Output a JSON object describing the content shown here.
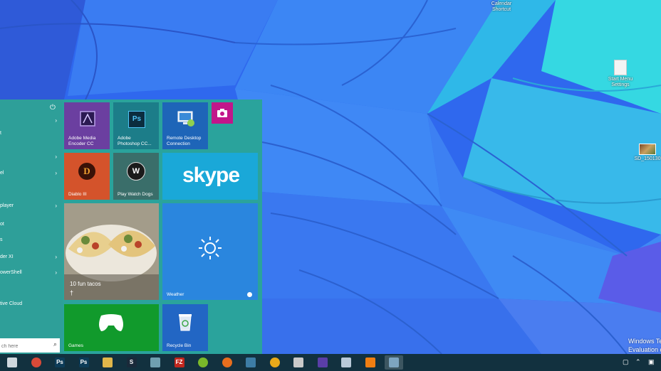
{
  "desktop": {
    "icons": [
      {
        "label": "Calendar Shortcut",
        "icon": "app-shortcut-icon"
      },
      {
        "label": "Start Menu Settings",
        "icon": "file-icon"
      },
      {
        "label": "SD_150130",
        "icon": "image-file-icon"
      }
    ],
    "watermark_line1": "Windows Tec",
    "watermark_line2": "Evaluation co"
  },
  "start_menu": {
    "power_icon": "power-icon",
    "left_items": [
      {
        "label": "",
        "chevron": true
      },
      {
        "label": "t",
        "chevron": false
      },
      {
        "label": "",
        "chevron": true
      },
      {
        "label": "el",
        "chevron": true
      },
      {
        "label": "player",
        "chevron": true
      },
      {
        "label": "ot",
        "chevron": false
      },
      {
        "label": "s",
        "chevron": false
      },
      {
        "label": "der XI",
        "chevron": true
      },
      {
        "label": "owerShell",
        "chevron": true
      },
      {
        "label": "tive Cloud",
        "chevron": false
      }
    ],
    "search_placeholder": "ch here",
    "search_icon": "search-icon",
    "tiles": {
      "media_encoder": {
        "label_line1": "Adobe Media",
        "label_line2": "Encoder CC",
        "color": "#6b3fa0"
      },
      "photoshop": {
        "label_line1": "Adobe",
        "label_line2": "Photoshop CC...",
        "glyph": "Ps",
        "color": "#1c7d89"
      },
      "remote_desktop": {
        "label_line1": "Remote Desktop",
        "label_line2": "Connection",
        "color": "#1e65b8"
      },
      "camera": {
        "icon": "camera-icon",
        "color": "#c2168a"
      },
      "diablo": {
        "label": "Diablo III",
        "glyph": "D",
        "color": "#d4532b"
      },
      "watch_dogs": {
        "label": "Play Watch Dogs",
        "glyph": "W",
        "color": "#3a6e6a"
      },
      "skype": {
        "label": "skype",
        "color": "#1aa8d8"
      },
      "food": {
        "label": "10 fun tacos",
        "color": "#8c8576"
      },
      "weather": {
        "label": "Weather",
        "color": "#2a86de"
      },
      "games": {
        "label": "Games",
        "color": "#119a2c"
      },
      "recycle_bin": {
        "label": "Recycle Bin",
        "color": "#2266c4"
      }
    }
  },
  "taskbar": {
    "apps": [
      {
        "name": "file-explorer-icon",
        "glyph": "",
        "color": "#cfd8de"
      },
      {
        "name": "chrome-icon",
        "glyph": "",
        "color": "#d94a38"
      },
      {
        "name": "photoshop-icon",
        "glyph": "Ps",
        "color": "#0d3c58"
      },
      {
        "name": "photoshop-cc-icon",
        "glyph": "Ps",
        "color": "#0d3c58"
      },
      {
        "name": "folder-icon",
        "glyph": "",
        "color": "#e0b64a"
      },
      {
        "name": "steam-icon",
        "glyph": "S",
        "color": "#1a2a3a"
      },
      {
        "name": "cloud-app-icon",
        "glyph": "",
        "color": "#6fa0b0"
      },
      {
        "name": "filezilla-icon",
        "glyph": "FZ",
        "color": "#c0271e"
      },
      {
        "name": "spotify-icon",
        "glyph": "",
        "color": "#7ab92a"
      },
      {
        "name": "firefox-icon",
        "glyph": "",
        "color": "#e76e1e"
      },
      {
        "name": "network-tool-icon",
        "glyph": "",
        "color": "#3d7da6"
      },
      {
        "name": "coin-icon",
        "glyph": "",
        "color": "#e8a91a"
      },
      {
        "name": "app-grid-icon",
        "glyph": "",
        "color": "#c9c9c9"
      },
      {
        "name": "settings-gear-icon",
        "glyph": "",
        "color": "#5a3ea8"
      },
      {
        "name": "recycle-bin-icon",
        "glyph": "",
        "color": "#b8c9d8"
      },
      {
        "name": "vlc-icon",
        "glyph": "",
        "color": "#f07e12"
      },
      {
        "name": "paint-icon",
        "glyph": "",
        "color": "#7da5c0"
      }
    ],
    "tray": [
      "action-center-icon",
      "chevron-up-icon",
      "network-icon"
    ]
  }
}
